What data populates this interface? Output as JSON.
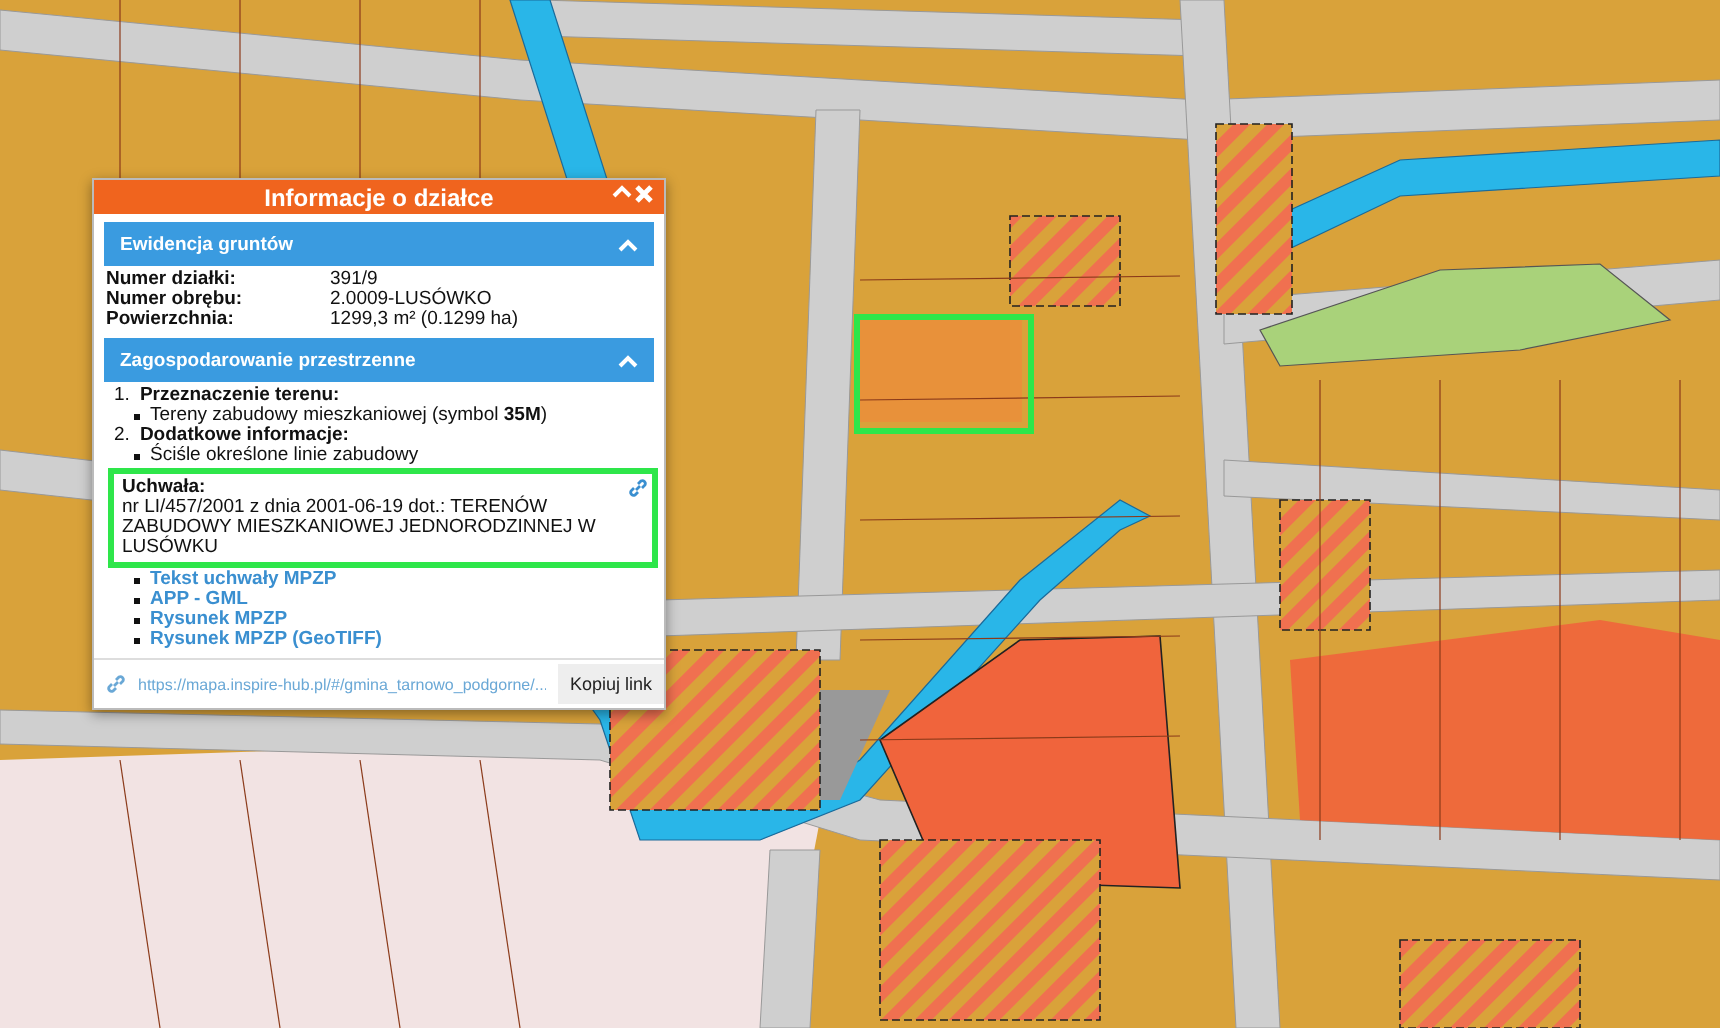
{
  "popup": {
    "title": "Informacje o działce",
    "sections": [
      {
        "title": "Ewidencja gruntów",
        "expanded": true,
        "kind": "fields",
        "fields": [
          {
            "label": "Numer działki:",
            "value": "391/9"
          },
          {
            "label": "Numer obrębu:",
            "value": "2.0009-LUSÓWKO"
          },
          {
            "label": "Powierzchnia:",
            "value": "1299,3 m² (0.1299 ha)"
          }
        ]
      },
      {
        "title": "Zagospodarowanie przestrzenne",
        "expanded": true,
        "kind": "plan",
        "items": [
          {
            "number": "1.",
            "heading": "Przeznaczenie terenu:",
            "bullets": [
              "Tereny zabudowy mieszkaniowej (symbol **35M**)"
            ]
          },
          {
            "number": "2.",
            "heading": "Dodatkowe informacje:",
            "bullets": [
              "Ściśle określone linie zabudowy"
            ]
          }
        ],
        "resolution": {
          "label": "Uchwała:",
          "text": "nr LI/457/2001 z dnia 2001-06-19 dot.: TERENÓW ZABUDOWY MIESZKANIOWEJ JEDNORODZINNEJ W LUSÓWKU",
          "highlighted": true
        },
        "links": [
          "Tekst uchwały MPZP",
          "APP - GML",
          "Rysunek MPZP",
          "Rysunek MPZP (GeoTIFF)"
        ]
      }
    ],
    "share_url": "https://mapa.inspire-hub.pl/#/gmina_tarnowo_podgorne/...",
    "copy_button": "Kopiuj link"
  }
}
